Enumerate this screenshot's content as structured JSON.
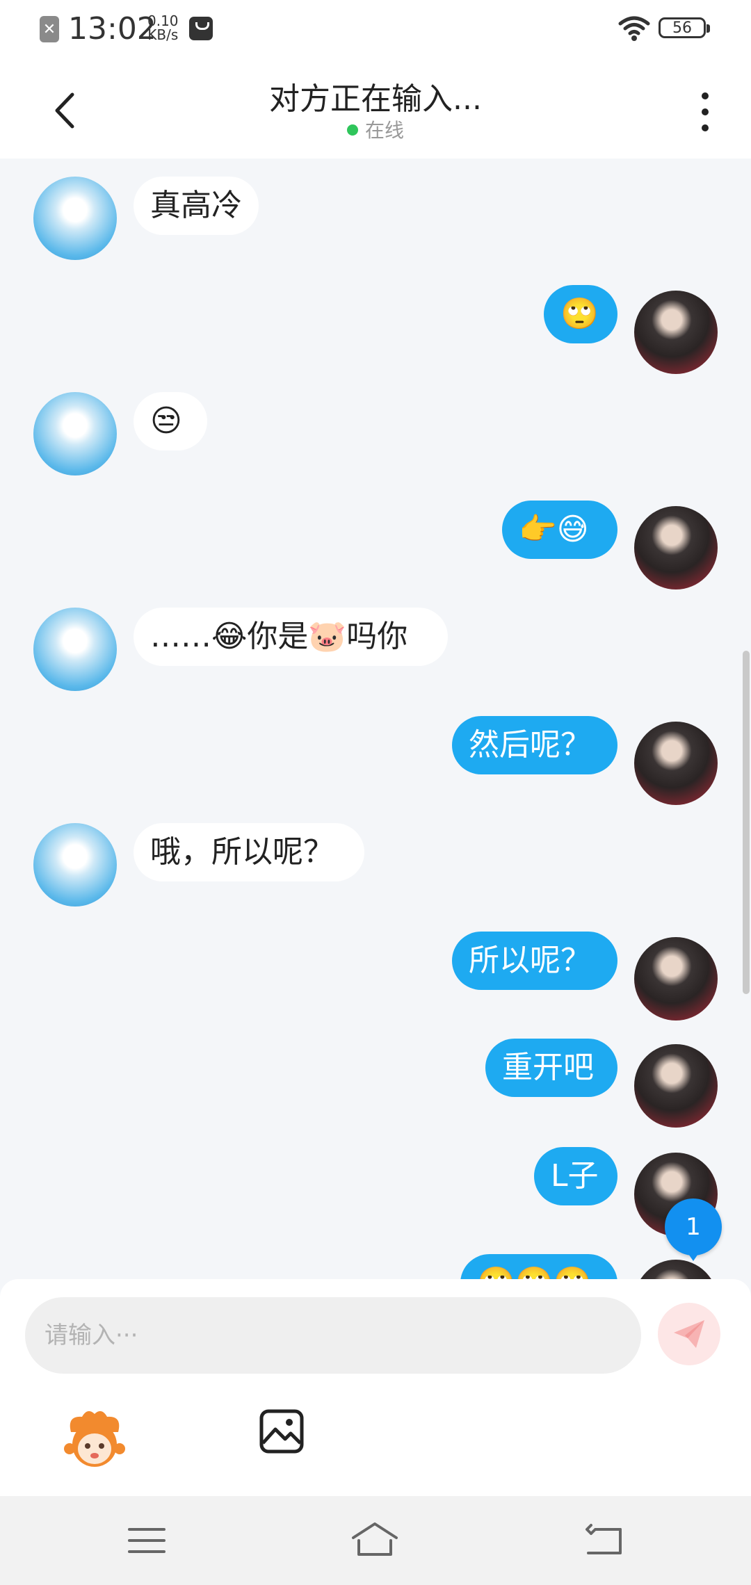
{
  "status_bar": {
    "time": "13:02",
    "rate_value": "0.10",
    "rate_unit": "KB/s",
    "battery": "56"
  },
  "header": {
    "title": "对方正在输入...",
    "status": "在线"
  },
  "messages": [
    {
      "side": "left",
      "text": "真高冷"
    },
    {
      "side": "right",
      "text": "🙄"
    },
    {
      "side": "left",
      "text": "😒"
    },
    {
      "side": "right",
      "text": "👉😅"
    },
    {
      "side": "left",
      "text": "……😂你是🐷吗你"
    },
    {
      "side": "right",
      "text": "然后呢？"
    },
    {
      "side": "left",
      "text": "哦，所以呢？"
    },
    {
      "side": "right",
      "text": "所以呢？"
    },
    {
      "side": "right",
      "text": "重开吧"
    },
    {
      "side": "right",
      "text": "L子"
    },
    {
      "side": "right",
      "text": "🙄🙄🙄"
    }
  ],
  "new_message_badge": "1",
  "input": {
    "placeholder": "请输入···"
  },
  "toolbar": {
    "emoji_icon": "mascot-emoji-icon",
    "image_icon": "image-icon"
  },
  "colors": {
    "outgoing_bubble": "#1eaaf1",
    "incoming_bubble": "#ffffff",
    "background": "#f4f6f9",
    "online": "#2fc55b",
    "badge": "#1290f0"
  }
}
